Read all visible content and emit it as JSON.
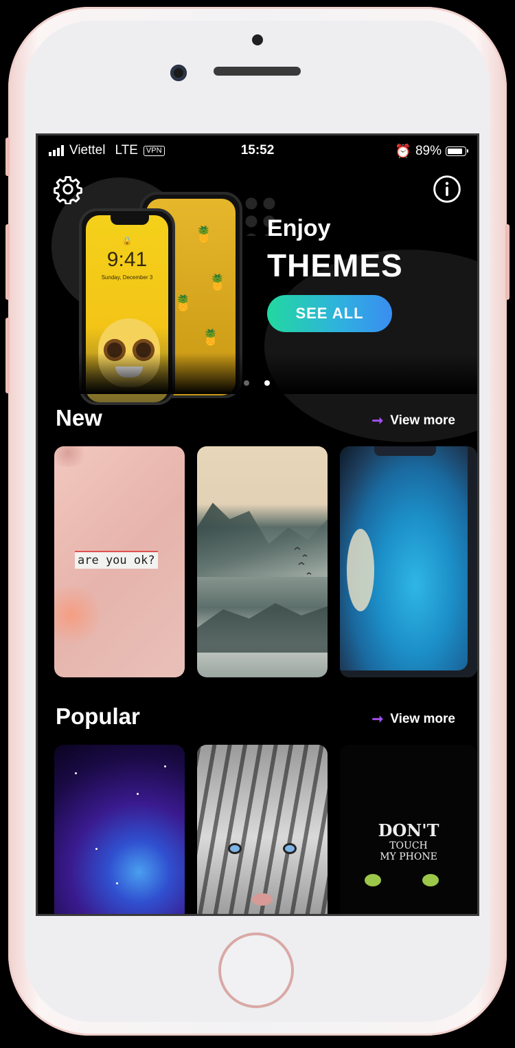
{
  "status_bar": {
    "carrier": "Viettel",
    "network": "LTE",
    "vpn": "VPN",
    "time": "15:52",
    "battery": "89%"
  },
  "banner": {
    "eyebrow": "Enjoy",
    "headline": "THEMES",
    "cta": "SEE ALL",
    "phone_preview": {
      "time": "9:41",
      "date": "Sunday, December 3"
    },
    "pages_total": 2,
    "page_active": 2
  },
  "sections": {
    "new": {
      "title": "New",
      "view_more": "View more",
      "cards": [
        {
          "name": "are-you-ok-wallpaper",
          "caption": "are you ok?"
        },
        {
          "name": "misty-mountains-wallpaper"
        },
        {
          "name": "ocean-airplane-window-wallpaper"
        }
      ]
    },
    "popular": {
      "title": "Popular",
      "view_more": "View more",
      "cards": [
        {
          "name": "galaxy-wallpaper"
        },
        {
          "name": "white-tiger-wallpaper"
        },
        {
          "name": "dont-touch-my-phone-wallpaper",
          "line1": "DON'T",
          "line2": "TOUCH",
          "line3": "MY PHONE"
        }
      ]
    }
  },
  "colors": {
    "accent_arrow": "#a350f0",
    "cta_gradient_start": "#22d8a0",
    "cta_gradient_end": "#3a8df0",
    "background": "#000000"
  },
  "icons": {
    "settings": "gear-icon",
    "info": "info-icon",
    "view_more": "arrow-right-icon"
  }
}
